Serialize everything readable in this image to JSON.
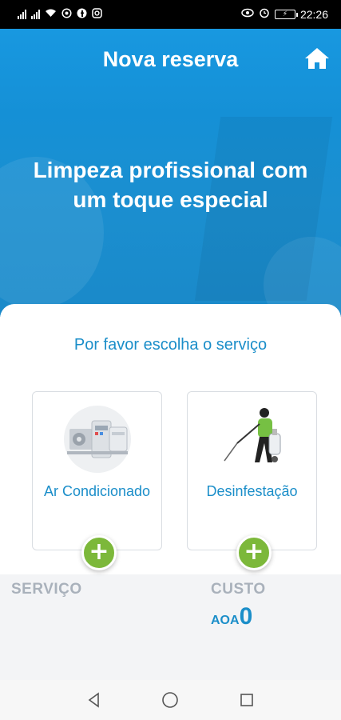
{
  "status_bar": {
    "time": "22:26",
    "battery": "⚡",
    "left_icons": [
      "signal-icon",
      "signal-icon",
      "wifi-icon",
      "whatsapp-icon",
      "facebook-icon",
      "instagram-icon"
    ],
    "right_icons": [
      "eye-icon",
      "alarm-icon",
      "battery-icon"
    ]
  },
  "header": {
    "title": "Nova reserva",
    "home_icon": "home-icon"
  },
  "hero": {
    "tagline": "Limpeza profissional com um toque especial"
  },
  "services": {
    "prompt": "Por favor escolha o serviço",
    "items": [
      {
        "label": "Ar Condicionado",
        "icon": "air-conditioner-icon",
        "add_symbol": "+"
      },
      {
        "label": "Desinfestação",
        "icon": "disinfection-worker-icon",
        "add_symbol": "+"
      }
    ]
  },
  "summary": {
    "service_label": "SERVIÇO",
    "cost_label": "CUSTO",
    "currency": "AOA",
    "amount": "0"
  },
  "nav": {
    "back_icon": "back-triangle-icon",
    "home_icon": "home-circle-icon",
    "recents_icon": "recents-square-icon"
  },
  "colors": {
    "primary": "#1b8ec9",
    "hero": "#1a92d8",
    "accent_green": "#7cb83a",
    "muted": "#a9b1bb"
  }
}
